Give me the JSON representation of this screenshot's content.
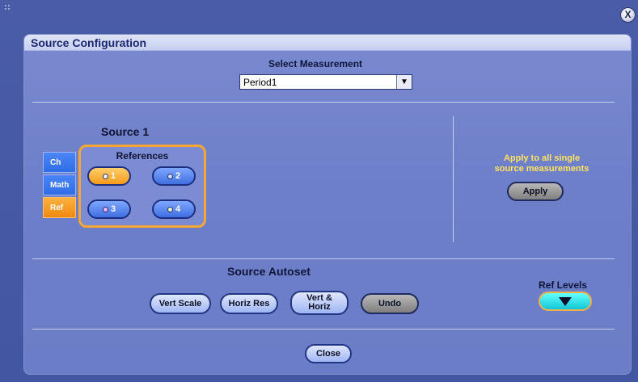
{
  "window": {
    "close_glyph": "X",
    "title": "Source Configuration"
  },
  "select_measurement": {
    "label": "Select Measurement",
    "value": "Period1",
    "arrow": "▼"
  },
  "source": {
    "title": "Source 1",
    "tabs": [
      {
        "label": "Ch",
        "active": false
      },
      {
        "label": "Math",
        "active": false
      },
      {
        "label": "Ref",
        "active": true
      }
    ],
    "references": {
      "title": "References",
      "buttons": [
        {
          "label": "1",
          "selected": true,
          "dot_color": "#ffffff"
        },
        {
          "label": "2",
          "selected": false,
          "dot_color": "#cfe0ff"
        },
        {
          "label": "3",
          "selected": false,
          "dot_color": "#f2b8ff"
        },
        {
          "label": "4",
          "selected": false,
          "dot_color": "#e6ffcc"
        }
      ]
    }
  },
  "apply_section": {
    "text_line1": "Apply to all single",
    "text_line2": "source measurements",
    "apply_label": "Apply"
  },
  "autoset": {
    "title": "Source Autoset",
    "buttons": {
      "vert_scale": "Vert Scale",
      "horiz_res": "Horiz Res",
      "vert_horiz_line1": "Vert &",
      "vert_horiz_line2": "Horiz",
      "undo": "Undo"
    }
  },
  "ref_levels": {
    "label": "Ref Levels"
  },
  "footer": {
    "close_label": "Close"
  },
  "colors": {
    "accent_orange": "#f7a632",
    "panel_blue": "#6d7fc9",
    "apply_text_yellow": "#ffe45c",
    "ref_levels_cyan": "#12c6d6"
  }
}
